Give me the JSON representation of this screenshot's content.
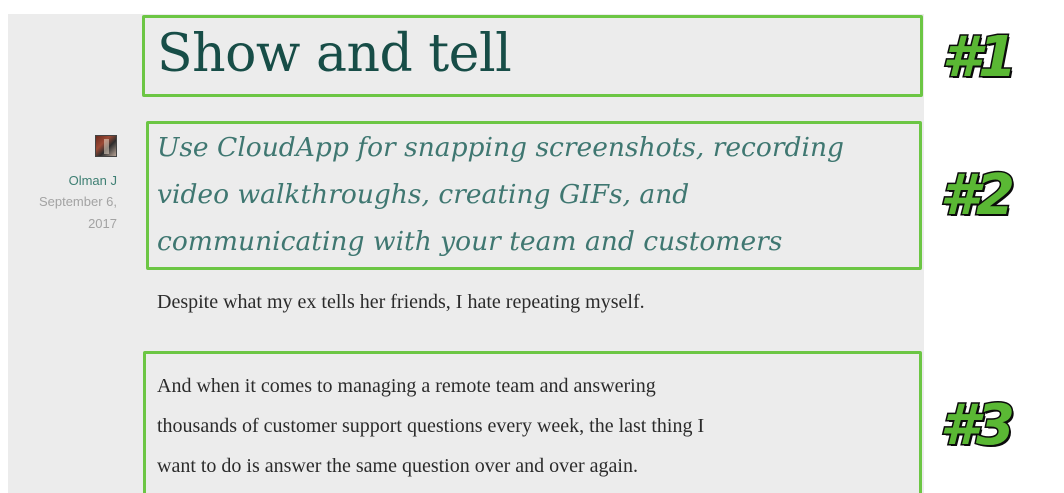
{
  "article": {
    "title": "Show and tell",
    "subtitle_lines": [
      "Use CloudApp for snapping screenshots, recording",
      "video walkthroughs, creating GIFs, and",
      "communicating with your team and customers"
    ],
    "paragraph_1": "Despite what my ex tells her friends, I hate repeating myself.",
    "paragraph_2_lines": [
      "And when it comes to managing a remote team and answering",
      "thousands of customer support questions every week, the last thing I",
      "want to do is answer the same question over and over again."
    ]
  },
  "byline": {
    "avatar_icon": "author-avatar-image",
    "author": "Olman J",
    "date_line_1": "September 6,",
    "date_line_2": "2017"
  },
  "annotations": {
    "badges": [
      "#1",
      "#2",
      "#3"
    ],
    "highlight_color": "#6cc644"
  },
  "colors": {
    "title": "#174d47",
    "subtitle": "#3f7771",
    "author": "#3e7f73",
    "date": "#a3a3a3",
    "body_text": "#2b2b2b",
    "article_background": "#ececec"
  }
}
